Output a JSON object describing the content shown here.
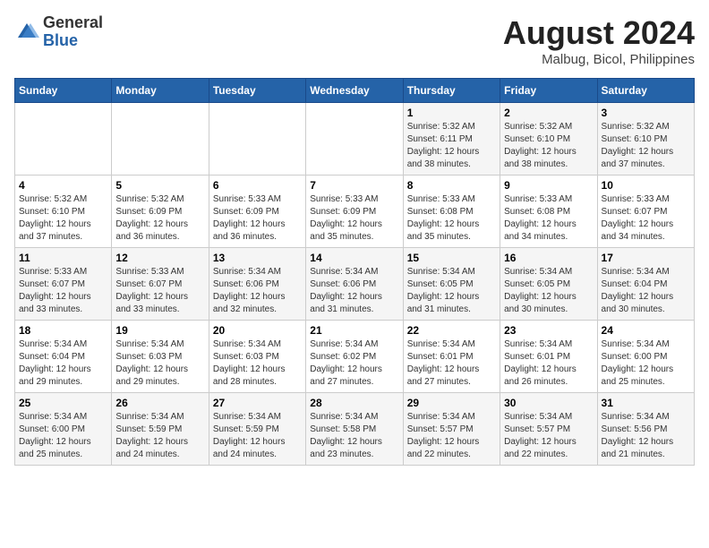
{
  "header": {
    "logo_general": "General",
    "logo_blue": "Blue",
    "title": "August 2024",
    "subtitle": "Malbug, Bicol, Philippines"
  },
  "calendar": {
    "days_of_week": [
      "Sunday",
      "Monday",
      "Tuesday",
      "Wednesday",
      "Thursday",
      "Friday",
      "Saturday"
    ],
    "weeks": [
      {
        "cells": [
          {
            "day": "",
            "info": ""
          },
          {
            "day": "",
            "info": ""
          },
          {
            "day": "",
            "info": ""
          },
          {
            "day": "",
            "info": ""
          },
          {
            "day": "1",
            "info": "Sunrise: 5:32 AM\nSunset: 6:11 PM\nDaylight: 12 hours\nand 38 minutes."
          },
          {
            "day": "2",
            "info": "Sunrise: 5:32 AM\nSunset: 6:10 PM\nDaylight: 12 hours\nand 38 minutes."
          },
          {
            "day": "3",
            "info": "Sunrise: 5:32 AM\nSunset: 6:10 PM\nDaylight: 12 hours\nand 37 minutes."
          }
        ]
      },
      {
        "cells": [
          {
            "day": "4",
            "info": "Sunrise: 5:32 AM\nSunset: 6:10 PM\nDaylight: 12 hours\nand 37 minutes."
          },
          {
            "day": "5",
            "info": "Sunrise: 5:32 AM\nSunset: 6:09 PM\nDaylight: 12 hours\nand 36 minutes."
          },
          {
            "day": "6",
            "info": "Sunrise: 5:33 AM\nSunset: 6:09 PM\nDaylight: 12 hours\nand 36 minutes."
          },
          {
            "day": "7",
            "info": "Sunrise: 5:33 AM\nSunset: 6:09 PM\nDaylight: 12 hours\nand 35 minutes."
          },
          {
            "day": "8",
            "info": "Sunrise: 5:33 AM\nSunset: 6:08 PM\nDaylight: 12 hours\nand 35 minutes."
          },
          {
            "day": "9",
            "info": "Sunrise: 5:33 AM\nSunset: 6:08 PM\nDaylight: 12 hours\nand 34 minutes."
          },
          {
            "day": "10",
            "info": "Sunrise: 5:33 AM\nSunset: 6:07 PM\nDaylight: 12 hours\nand 34 minutes."
          }
        ]
      },
      {
        "cells": [
          {
            "day": "11",
            "info": "Sunrise: 5:33 AM\nSunset: 6:07 PM\nDaylight: 12 hours\nand 33 minutes."
          },
          {
            "day": "12",
            "info": "Sunrise: 5:33 AM\nSunset: 6:07 PM\nDaylight: 12 hours\nand 33 minutes."
          },
          {
            "day": "13",
            "info": "Sunrise: 5:34 AM\nSunset: 6:06 PM\nDaylight: 12 hours\nand 32 minutes."
          },
          {
            "day": "14",
            "info": "Sunrise: 5:34 AM\nSunset: 6:06 PM\nDaylight: 12 hours\nand 31 minutes."
          },
          {
            "day": "15",
            "info": "Sunrise: 5:34 AM\nSunset: 6:05 PM\nDaylight: 12 hours\nand 31 minutes."
          },
          {
            "day": "16",
            "info": "Sunrise: 5:34 AM\nSunset: 6:05 PM\nDaylight: 12 hours\nand 30 minutes."
          },
          {
            "day": "17",
            "info": "Sunrise: 5:34 AM\nSunset: 6:04 PM\nDaylight: 12 hours\nand 30 minutes."
          }
        ]
      },
      {
        "cells": [
          {
            "day": "18",
            "info": "Sunrise: 5:34 AM\nSunset: 6:04 PM\nDaylight: 12 hours\nand 29 minutes."
          },
          {
            "day": "19",
            "info": "Sunrise: 5:34 AM\nSunset: 6:03 PM\nDaylight: 12 hours\nand 29 minutes."
          },
          {
            "day": "20",
            "info": "Sunrise: 5:34 AM\nSunset: 6:03 PM\nDaylight: 12 hours\nand 28 minutes."
          },
          {
            "day": "21",
            "info": "Sunrise: 5:34 AM\nSunset: 6:02 PM\nDaylight: 12 hours\nand 27 minutes."
          },
          {
            "day": "22",
            "info": "Sunrise: 5:34 AM\nSunset: 6:01 PM\nDaylight: 12 hours\nand 27 minutes."
          },
          {
            "day": "23",
            "info": "Sunrise: 5:34 AM\nSunset: 6:01 PM\nDaylight: 12 hours\nand 26 minutes."
          },
          {
            "day": "24",
            "info": "Sunrise: 5:34 AM\nSunset: 6:00 PM\nDaylight: 12 hours\nand 25 minutes."
          }
        ]
      },
      {
        "cells": [
          {
            "day": "25",
            "info": "Sunrise: 5:34 AM\nSunset: 6:00 PM\nDaylight: 12 hours\nand 25 minutes."
          },
          {
            "day": "26",
            "info": "Sunrise: 5:34 AM\nSunset: 5:59 PM\nDaylight: 12 hours\nand 24 minutes."
          },
          {
            "day": "27",
            "info": "Sunrise: 5:34 AM\nSunset: 5:59 PM\nDaylight: 12 hours\nand 24 minutes."
          },
          {
            "day": "28",
            "info": "Sunrise: 5:34 AM\nSunset: 5:58 PM\nDaylight: 12 hours\nand 23 minutes."
          },
          {
            "day": "29",
            "info": "Sunrise: 5:34 AM\nSunset: 5:57 PM\nDaylight: 12 hours\nand 22 minutes."
          },
          {
            "day": "30",
            "info": "Sunrise: 5:34 AM\nSunset: 5:57 PM\nDaylight: 12 hours\nand 22 minutes."
          },
          {
            "day": "31",
            "info": "Sunrise: 5:34 AM\nSunset: 5:56 PM\nDaylight: 12 hours\nand 21 minutes."
          }
        ]
      }
    ]
  }
}
